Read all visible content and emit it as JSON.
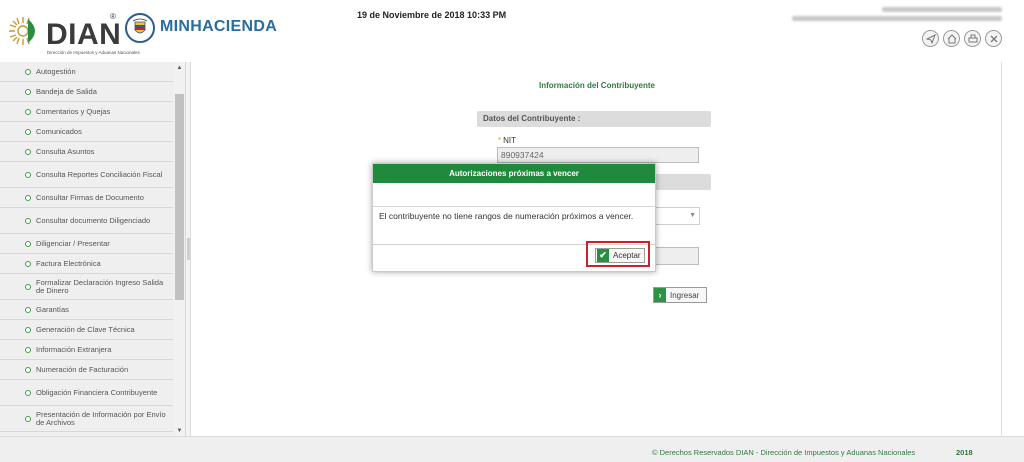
{
  "header": {
    "brand_name": "DIAN",
    "brand_subtitle": "Dirección de Impuestos y Aduanas Nacionales",
    "registered_mark": "®",
    "ministry": "MINHACIENDA",
    "datetime": "19 de Noviembre de 2018 10:33 PM",
    "icons": [
      "send-icon",
      "home-icon",
      "print-icon",
      "close-icon"
    ]
  },
  "sidebar": {
    "items": [
      {
        "label": "Autogestión",
        "size": "single"
      },
      {
        "label": "Bandeja de Salida",
        "size": "single"
      },
      {
        "label": "Comentarios y Quejas",
        "size": "single"
      },
      {
        "label": "Comunicados",
        "size": "single"
      },
      {
        "label": "Consulta Asuntos",
        "size": "single"
      },
      {
        "label": "Consulta Reportes Conciliación Fiscal",
        "size": "double"
      },
      {
        "label": "Consultar Firmas de Documento",
        "size": "single"
      },
      {
        "label": "Consultar documento Diligenciado",
        "size": "double"
      },
      {
        "label": "Diligenciar / Presentar",
        "size": "single"
      },
      {
        "label": "Factura Electrónica",
        "size": "single"
      },
      {
        "label": "Formalizar Declaración Ingreso Salida de Dinero",
        "size": "double"
      },
      {
        "label": "Garantías",
        "size": "single"
      },
      {
        "label": "Generación de Clave Técnica",
        "size": "single"
      },
      {
        "label": "Información Extranjera",
        "size": "single"
      },
      {
        "label": "Numeración de Facturación",
        "size": "single"
      },
      {
        "label": "Obligación Financiera Contribuyente",
        "size": "double"
      },
      {
        "label": "Presentación de Información por Envío de Archivos",
        "size": "double"
      }
    ]
  },
  "main": {
    "title": "Información del Contribuyente",
    "section_header": "Datos del Contribuyente :",
    "nit_required_mark": "*",
    "nit_label": "NIT",
    "nit_value": "890937424",
    "submit_label": "Ingresar"
  },
  "modal": {
    "title": "Autorizaciones próximas a vencer",
    "message": "El contribuyente no tiene rangos de numeración próximos a vencer.",
    "accept_label": "Aceptar"
  },
  "footer": {
    "copyright": "© Derechos Reservados DIAN - Dirección de Impuestos y Aduanas Nacionales",
    "year": "2018"
  },
  "colors": {
    "brand_green": "#1f8a3b",
    "bullet_green": "#3ba146",
    "ministry_blue": "#2a6d9c",
    "highlight_red": "#c8232a"
  }
}
